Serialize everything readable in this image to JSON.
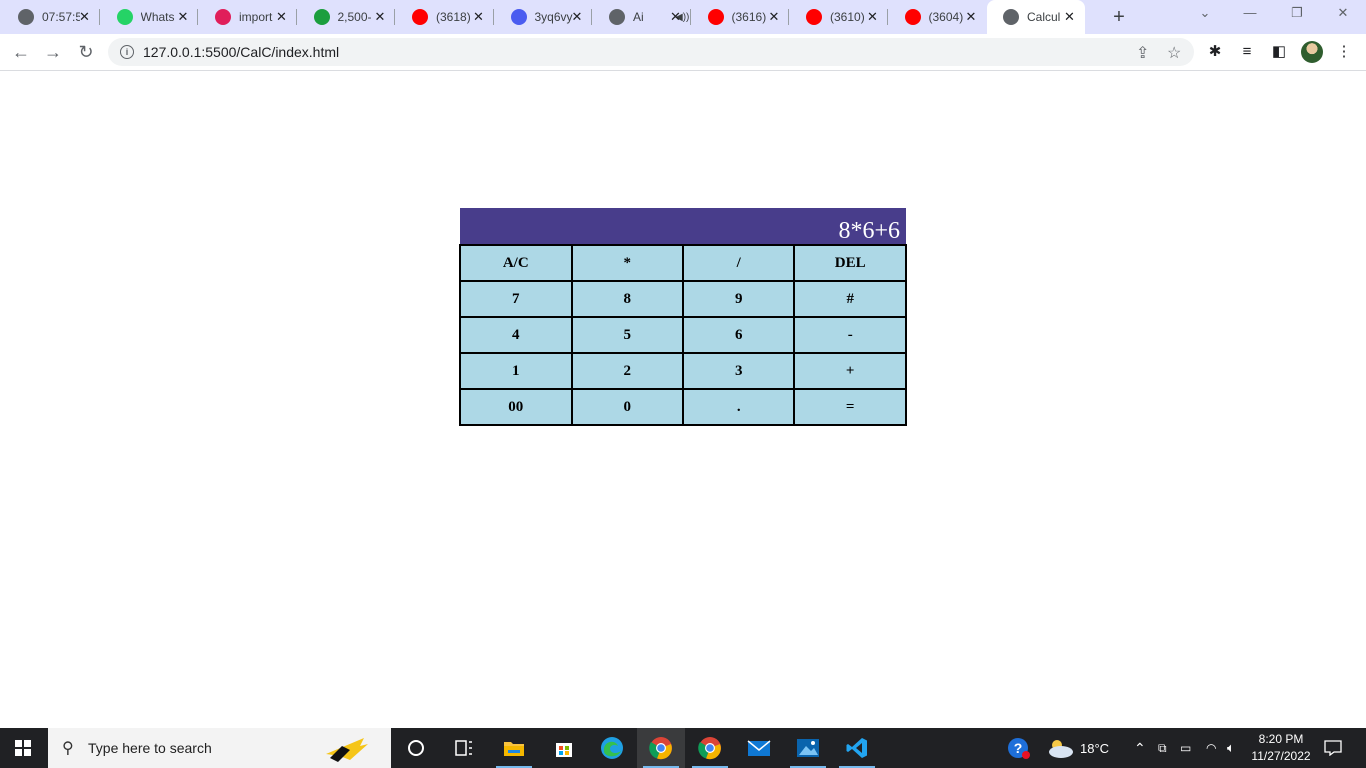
{
  "browser": {
    "tabs": [
      {
        "title": "07:57:5",
        "favicon": "clock-check-icon",
        "color": "#5f6368"
      },
      {
        "title": "Whats",
        "favicon": "whatsapp-icon",
        "color": "#25d366"
      },
      {
        "title": "import",
        "favicon": "slack-icon",
        "color": "#e01e5a"
      },
      {
        "title": "2,500-",
        "favicon": "codecademy-icon",
        "color": "#1b9e3e"
      },
      {
        "title": "(3618)",
        "favicon": "youtube-icon",
        "color": "#ff0000"
      },
      {
        "title": "3yq6vy",
        "favicon": "code-icon",
        "color": "#4a5cf0"
      },
      {
        "title": "Ai",
        "favicon": "globe-icon",
        "color": "#5f6368"
      },
      {
        "title": "(3616)",
        "favicon": "youtube-icon",
        "color": "#ff0000"
      },
      {
        "title": "(3610)",
        "favicon": "youtube-icon",
        "color": "#ff0000"
      },
      {
        "title": "(3604)",
        "favicon": "youtube-icon",
        "color": "#ff0000"
      },
      {
        "title": "Calcul",
        "favicon": "globe-icon",
        "color": "#5f6368"
      }
    ],
    "active_tab": 10,
    "url": "127.0.0.1:5500/CalC/index.html"
  },
  "calculator": {
    "display": "8*6+6",
    "rows": [
      [
        "A/C",
        "*",
        "/",
        "DEL"
      ],
      [
        "7",
        "8",
        "9",
        "#"
      ],
      [
        "4",
        "5",
        "6",
        "-"
      ],
      [
        "1",
        "2",
        "3",
        "+"
      ],
      [
        "00",
        "0",
        ".",
        "="
      ]
    ],
    "display_color": "#483d8b",
    "button_color": "#add8e6"
  },
  "taskbar": {
    "search_placeholder": "Type here to search",
    "weather": "18°C",
    "time": "8:20 PM",
    "date": "11/27/2022"
  }
}
